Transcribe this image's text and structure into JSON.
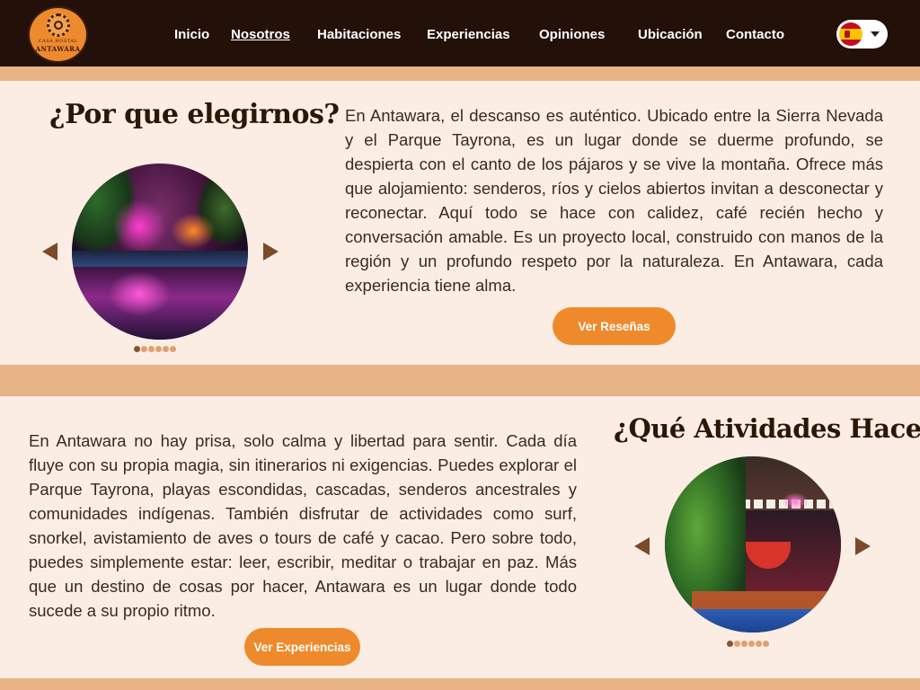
{
  "brand": {
    "logo_top": "CASA HOSTAL",
    "logo_main": "ANTAWARA"
  },
  "nav": {
    "items": [
      {
        "label": "Inicio",
        "active": false
      },
      {
        "label": "Nosotros",
        "active": true
      },
      {
        "label": "Habitaciones",
        "active": false
      },
      {
        "label": "Experiencias",
        "active": false
      },
      {
        "label": "Opiniones",
        "active": false
      },
      {
        "label": "Ubicación",
        "active": false
      },
      {
        "label": "Contacto",
        "active": false
      }
    ],
    "language": {
      "icon": "spain-flag-icon",
      "caret_icon": "chevron-down-icon"
    }
  },
  "colors": {
    "nav_bg": "#231009",
    "page_bg": "#fbede3",
    "band": "#e8b385",
    "accent": "#ef8a2c",
    "heading": "#2b1608",
    "arrow": "#7a4a2a"
  },
  "section_why": {
    "title": "¿Por que elegirnos?",
    "body": "En Antawara, el descanso es auténtico. Ubicado entre la Sierra Nevada y el Parque Tayrona, es un lugar donde se duerme profundo, se despierta con el canto de los pájaros y se vive la montaña. Ofrece más que alojamiento: senderos, ríos y cielos abiertos invitan a desconectar y reconectar. Aquí todo se hace con calidez, café recién hecho y conversación amable. Es un proyecto local, construido con manos de la región y un profundo respeto por la naturaleza. En Antawara, cada experiencia tiene alma.",
    "button": "Ver Reseñas",
    "carousel": {
      "slides": 6,
      "active": 0,
      "prev_icon": "arrow-left-icon",
      "next_icon": "arrow-right-icon"
    }
  },
  "section_activities": {
    "title": "¿Qué Atividades Hacer?",
    "body": "En Antawara no hay prisa, solo calma y libertad para sentir. Cada día fluye con su propia magia, sin itinerarios ni exigencias. Puedes explorar el Parque Tayrona, playas escondidas, cascadas, senderos ancestrales y comunidades indígenas. También disfrutar de actividades como surf, snorkel, avistamiento de aves o tours de café y cacao. Pero sobre todo, puedes simplemente estar: leer, escribir, meditar o trabajar en paz. Más que un destino de cosas por hacer, Antawara es un lugar donde todo sucede a su propio ritmo.",
    "button": "Ver Experiencias",
    "carousel": {
      "slides": 6,
      "active": 0,
      "prev_icon": "arrow-left-icon",
      "next_icon": "arrow-right-icon"
    }
  }
}
